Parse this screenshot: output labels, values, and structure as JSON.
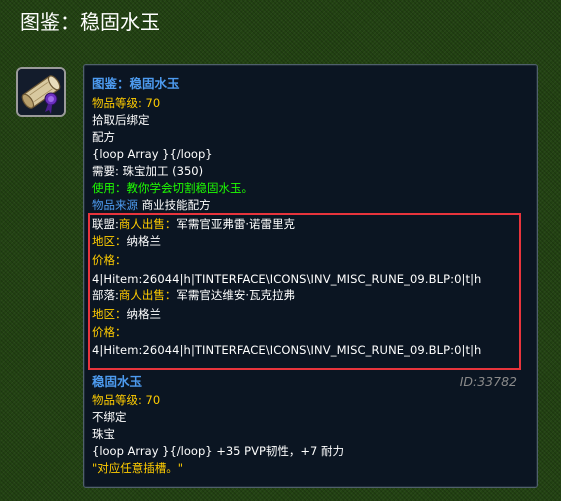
{
  "page_title": "图鉴：稳固水玉",
  "colors": {
    "background": "#224212",
    "tooltip_bg": "#0b1522",
    "item_name_blue": "#4d9bf0",
    "label_yellow": "#ffcc00",
    "use_green": "#1eff00",
    "highlight_red": "#e8343c"
  },
  "recipe": {
    "icon": "scroll-recipe-icon",
    "name": "图鉴：稳固水玉",
    "item_level_label": "物品等级:",
    "item_level_value": "70",
    "binding": "拾取后绑定",
    "type": "配方",
    "loop_text": "{loop Array }{/loop}",
    "requires": "需要: 珠宝加工 (350)",
    "use_text": "使用：教你学会切割稳固水玉。",
    "source_label": "物品来源",
    "source_value": "商业技能配方"
  },
  "vendors": {
    "alliance": {
      "faction": "联盟:",
      "seller_label": "商人出售：",
      "seller_name": "军需官亚弗雷·诺雷里克",
      "area_label": "地区：",
      "area_value": "纳格兰",
      "price_label": "价格：",
      "price_value": "4|Hitem:26044|h|TINTERFACE\\ICONS\\INV_MISC_RUNE_09.BLP:0|t|h"
    },
    "horde": {
      "faction": "部落:",
      "seller_label": "商人出售：",
      "seller_name": "军需官达维安·瓦克拉弗",
      "area_label": "地区：",
      "area_value": "纳格兰",
      "price_label": "价格：",
      "price_value": "4|Hitem:26044|h|TINTERFACE\\ICONS\\INV_MISC_RUNE_09.BLP:0|t|h"
    }
  },
  "crafted_item": {
    "name": "稳固水玉",
    "id_text": "ID:33782",
    "item_level_label": "物品等级:",
    "item_level_value": "70",
    "binding": "不绑定",
    "type": "珠宝",
    "stats": "{loop Array }{/loop} +35 PVP韧性，+7 耐力",
    "socket_note": "\"对应任意插槽。\""
  }
}
